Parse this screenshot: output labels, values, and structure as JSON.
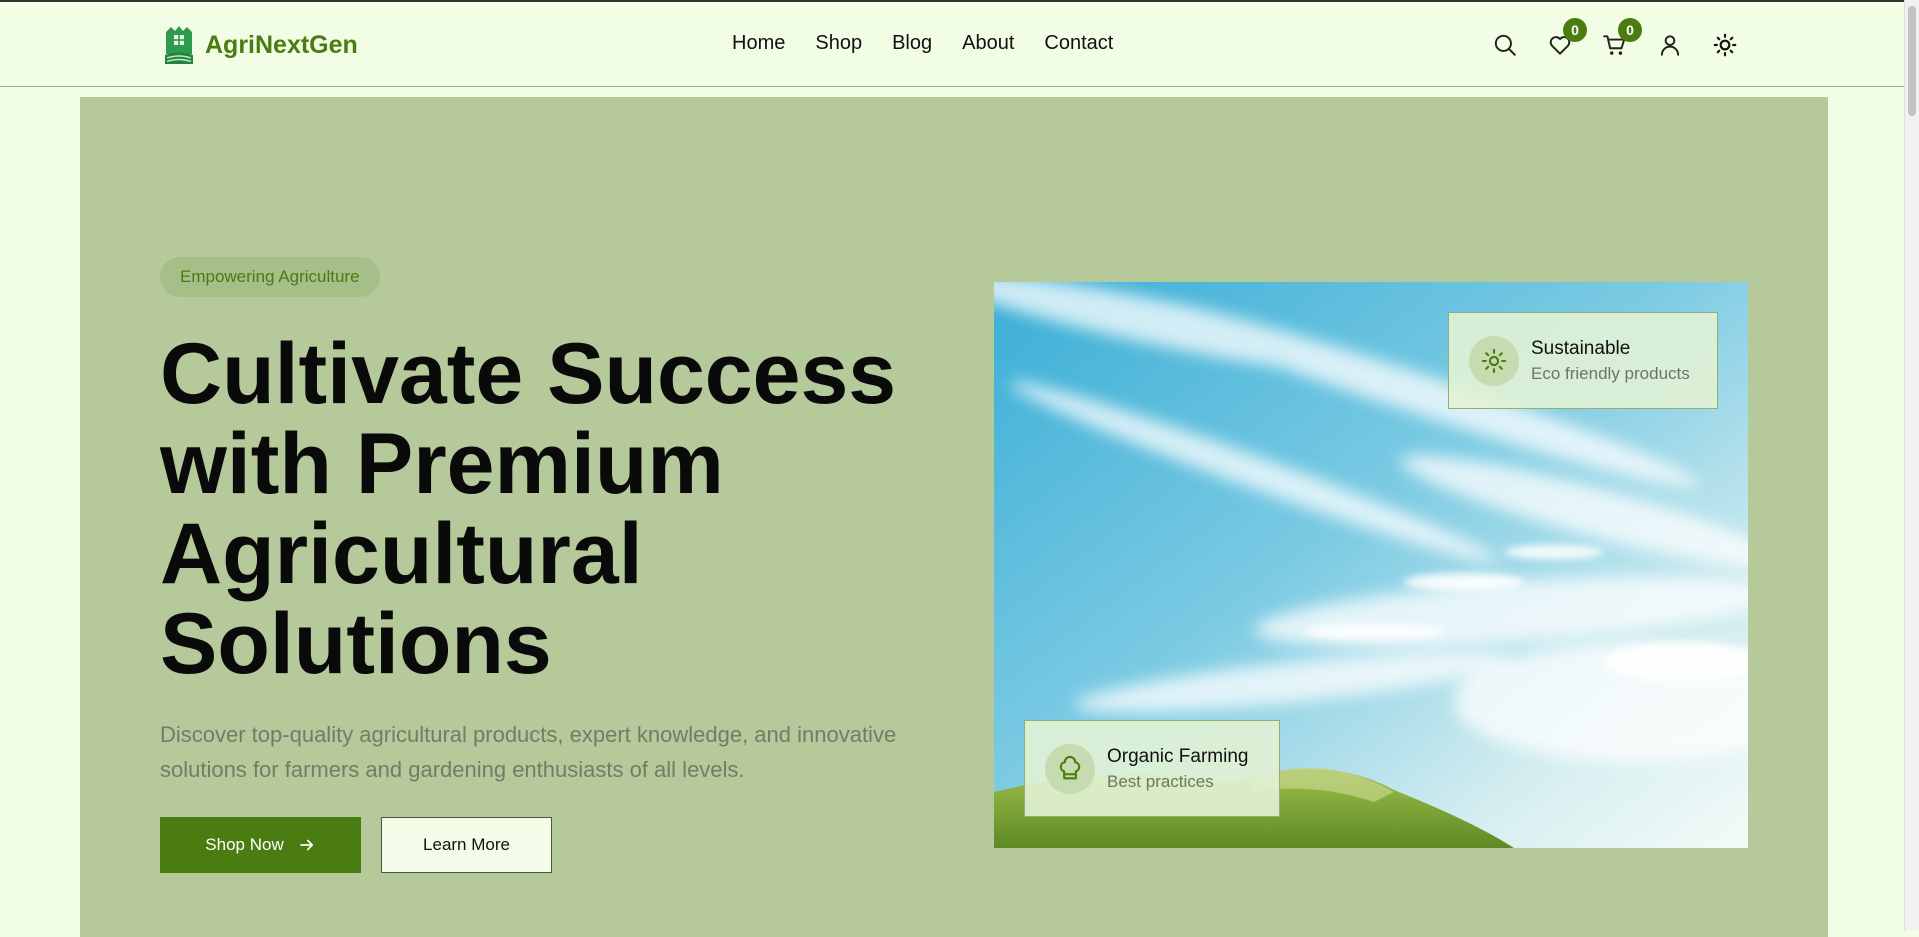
{
  "brand": {
    "name": "AgriNextGen",
    "accent": "#4a7c12",
    "background": "#f1fde4",
    "hero_background": "#b5c99a"
  },
  "nav": {
    "items": [
      {
        "label": "Home"
      },
      {
        "label": "Shop"
      },
      {
        "label": "Blog"
      },
      {
        "label": "About"
      },
      {
        "label": "Contact"
      }
    ]
  },
  "header_icons": {
    "search": "search-icon",
    "wishlist": {
      "icon": "heart-icon",
      "count": "0"
    },
    "cart": {
      "icon": "cart-icon",
      "count": "0"
    },
    "account": "user-icon",
    "theme": "sun-icon"
  },
  "hero": {
    "tag": "Empowering Agriculture",
    "headline": "Cultivate Success with Premium Agricultural Solutions",
    "description": "Discover top-quality agricultural products, expert knowledge, and innovative solutions for farmers and gardening enthusiasts of all levels.",
    "primary_button": "Shop Now",
    "secondary_button": "Learn More",
    "features": [
      {
        "title": "Sustainable",
        "subtitle": "Eco friendly products",
        "icon": "sun-icon"
      },
      {
        "title": "Organic Farming",
        "subtitle": "Best practices",
        "icon": "chef-hat-icon"
      }
    ]
  }
}
